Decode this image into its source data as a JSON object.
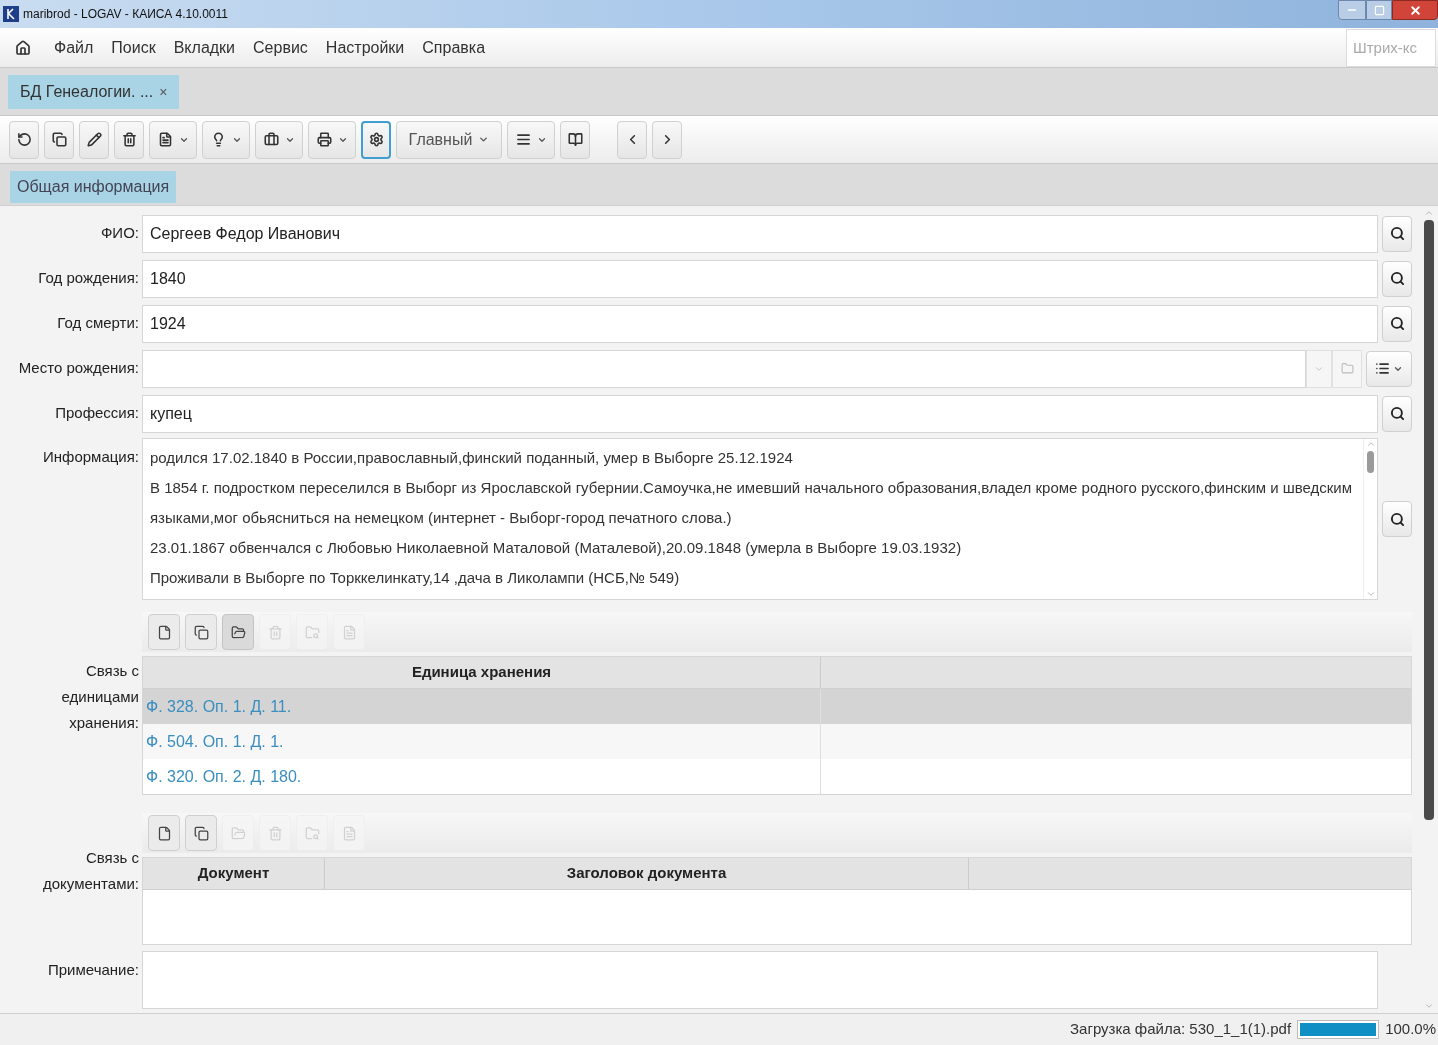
{
  "window": {
    "title": "maribrod - LOGAV - КАИСА 4.10.0011"
  },
  "menu": [
    "Файл",
    "Поиск",
    "Вкладки",
    "Сервис",
    "Настройки",
    "Справка"
  ],
  "barcode": {
    "placeholder": "Штрих-кс"
  },
  "tabs": [
    {
      "label": "БД Генеалогии. ...",
      "close": "×",
      "selected": true
    }
  ],
  "toolbar": [
    {
      "kind": "icon",
      "active": false
    },
    {
      "kind": "icon",
      "active": false
    },
    {
      "kind": "icon",
      "active": false
    },
    {
      "kind": "icon",
      "active": false
    },
    {
      "kind": "dropdown",
      "active": false
    },
    {
      "kind": "dropdown",
      "active": false
    },
    {
      "kind": "dropdown",
      "active": false
    },
    {
      "kind": "dropdown",
      "active": false
    },
    {
      "kind": "icon",
      "active": true
    },
    {
      "kind": "select",
      "label": "Главный",
      "active": false
    },
    {
      "kind": "dropdown",
      "active": false
    },
    {
      "kind": "icon",
      "active": false
    },
    {
      "kind": "icon",
      "active": false
    },
    {
      "kind": "icon",
      "active": false
    }
  ],
  "sections": [
    {
      "label": "Общая информация",
      "selected": true
    }
  ],
  "fields": [
    {
      "kind": "search",
      "label": "ФИО:",
      "value": "Сергеев Федор Иванович"
    },
    {
      "kind": "search",
      "label": "Год рождения:",
      "value": "1840"
    },
    {
      "kind": "search",
      "label": "Год смерти:",
      "value": "1924"
    },
    {
      "kind": "combo",
      "label": "Место рождения:"
    },
    {
      "kind": "search",
      "label": "Профессия:",
      "value": "купец"
    }
  ],
  "information": {
    "label": "Информация:",
    "paragraphs": [
      "родился 17.02.1840 в России,православный,финский поданный, умер в Выборге 25.12.1924",
      "В 1854 г. подростком переселился в Выборг из Ярославской губернии.Самоучка,не имевший начального образования,владел кроме родного русского,финским и шведским языками,мог обьясниться на немецком (интернет - Выборг-город печатного слова.)",
      "23.01.1867 обвенчался с Любовью Николаевной Маталовой (Маталевой),20.09.1848 (умерла в Выборге 19.03.1932)",
      "Проживали в Выборге по Торккелинкату,14 ,дача в Ликолампи (НСБ,№ 549)"
    ]
  },
  "storage_units": {
    "label": "Связь с единицами хранения:",
    "tools": [
      {
        "disabled": false,
        "pressed": false
      },
      {
        "disabled": false,
        "pressed": false
      },
      {
        "disabled": false,
        "pressed": true
      },
      {
        "disabled": true,
        "pressed": false
      },
      {
        "disabled": true,
        "pressed": false
      },
      {
        "disabled": true,
        "pressed": false
      }
    ],
    "columns": [
      "Единица хранения"
    ],
    "rows": [
      {
        "cell": "Ф. 328. Оп. 1. Д. 11.",
        "selected": true
      },
      {
        "cell": "Ф. 504. Оп. 1. Д. 1.",
        "selected": false
      },
      {
        "cell": "Ф. 320. Оп. 2. Д. 180.",
        "selected": false
      }
    ]
  },
  "documents": {
    "label": "Связь с документами:",
    "tools": [
      {
        "disabled": false,
        "pressed": false
      },
      {
        "disabled": false,
        "pressed": false
      },
      {
        "disabled": true,
        "pressed": false
      },
      {
        "disabled": true,
        "pressed": false
      },
      {
        "disabled": true,
        "pressed": false
      },
      {
        "disabled": true,
        "pressed": false
      }
    ],
    "columns": [
      "Документ",
      "Заголовок документа"
    ]
  },
  "note": {
    "label": "Примечание:"
  },
  "status_bar": {
    "text": "Загрузка файла: 530_1_1(1).pdf",
    "level": 1.0,
    "reading": "100.0%"
  }
}
